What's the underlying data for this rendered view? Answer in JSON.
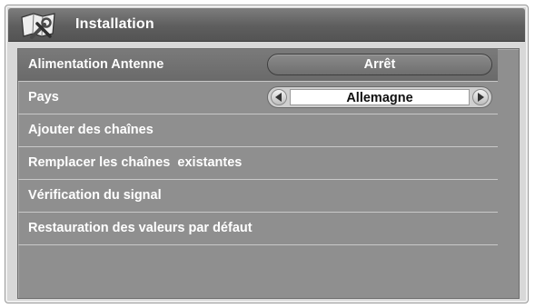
{
  "header": {
    "title": "Installation",
    "icon": "tools-icon"
  },
  "menu": {
    "items": [
      {
        "label": "Alimentation Antenne",
        "value": "Arrêt",
        "control": "pill"
      },
      {
        "label": "Pays",
        "value": "Allemagne",
        "control": "selector"
      },
      {
        "label": "Ajouter des chaînes"
      },
      {
        "label": "Remplacer les chaînes  existantes"
      },
      {
        "label": "Vérification du signal"
      },
      {
        "label": "Restauration des valeurs par défaut"
      }
    ],
    "selected_index": 0
  },
  "colors": {
    "panel": "#d8d8d8",
    "title_bar": "#5e5e5e",
    "content": "#8f8f8f",
    "text": "#ffffff"
  }
}
